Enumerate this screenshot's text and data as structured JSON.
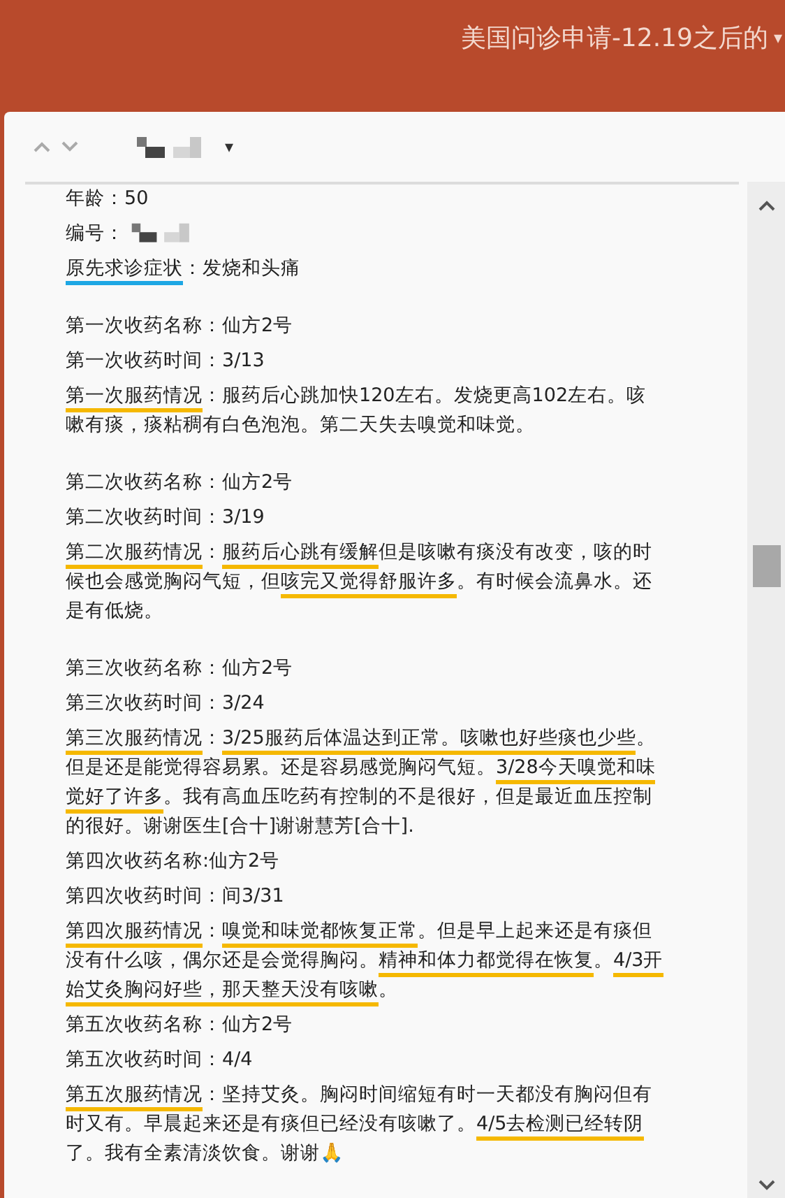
{
  "header": {
    "title": "美国问诊申请-12.19之后的",
    "menu_glyph": "▾"
  },
  "toolbar": {
    "sender_caret": "▾"
  },
  "sections": [
    {
      "lines": [
        {
          "kind": "text",
          "segments": [
            {
              "text": "年龄：50"
            }
          ]
        },
        {
          "kind": "redacted",
          "segments": [
            {
              "text": "编号："
            }
          ]
        },
        {
          "kind": "text",
          "segments": [
            {
              "text": "原先求诊症状",
              "color": "#1ea7e4"
            },
            {
              "text": "：发烧和头痛"
            }
          ]
        }
      ]
    },
    {
      "lines": [
        {
          "kind": "text",
          "segments": [
            {
              "text": "第一次收药名称：仙方2号"
            }
          ]
        },
        {
          "kind": "text",
          "segments": [
            {
              "text": "第一次收药时间：3/13"
            }
          ]
        },
        {
          "kind": "text",
          "segments": [
            {
              "text": "第一次服药情况",
              "color": "#f5b800"
            },
            {
              "text": "：服药后心跳加快120左右。发烧更高102左右。咳嗽有痰，痰粘稠有白色泡泡。第二天失去嗅觉和味觉。"
            }
          ]
        }
      ]
    },
    {
      "lines": [
        {
          "kind": "text",
          "segments": [
            {
              "text": "第二次收药名称：仙方2号"
            }
          ]
        },
        {
          "kind": "text",
          "segments": [
            {
              "text": "第二次收药时间：3/19"
            }
          ]
        },
        {
          "kind": "text",
          "segments": [
            {
              "text": "第二次服药情况",
              "color": "#f5b800"
            },
            {
              "text": "："
            },
            {
              "text": "服药后心跳有缓解",
              "color": "#f5b800"
            },
            {
              "text": "但是咳嗽有痰没有改变，咳的时候也会感觉胸闷气短，但"
            },
            {
              "text": "咳完又觉得舒服许多",
              "color": "#f5b800"
            },
            {
              "text": "。有时候会流鼻水。还是有低烧。"
            }
          ]
        }
      ]
    },
    {
      "lines": [
        {
          "kind": "text",
          "segments": [
            {
              "text": "第三次收药名称：仙方2号"
            }
          ]
        },
        {
          "kind": "text",
          "segments": [
            {
              "text": "第三次收药时间：3/24"
            }
          ]
        },
        {
          "kind": "text",
          "segments": [
            {
              "text": "第三次服药情况",
              "color": "#f5b800"
            },
            {
              "text": "："
            },
            {
              "text": "3/25服药后体温达到正常。咳嗽也好些痰也少些",
              "color": "#f5b800"
            },
            {
              "text": "。但是还是能觉得容易累。还是容易感觉胸闷气短。"
            },
            {
              "text": "3/28今天嗅觉和味觉好了许多",
              "color": "#f5b800"
            },
            {
              "text": "。我有高血压吃药有控制的不是很好，但是最近血压控制的很好。谢谢医生[合十]谢谢慧芳[合十]."
            }
          ]
        },
        {
          "kind": "text",
          "segments": [
            {
              "text": "第四次收药名称:仙方2号"
            }
          ]
        },
        {
          "kind": "text",
          "segments": [
            {
              "text": "第四次收药时间：间3/31"
            }
          ]
        },
        {
          "kind": "text",
          "segments": [
            {
              "text": "第四次服药情况",
              "color": "#f5b800"
            },
            {
              "text": "："
            },
            {
              "text": "嗅觉和味觉都恢复正常",
              "color": "#f5b800"
            },
            {
              "text": "。但是早上起来还是有痰但没有什么咳，偶尔还是会觉得胸闷。"
            },
            {
              "text": "精神和体力都觉得在恢复",
              "color": "#f5b800"
            },
            {
              "text": "。"
            },
            {
              "text": "4/3开始艾灸胸闷好些，那天整天没有咳嗽",
              "color": "#f5b800"
            },
            {
              "text": "。"
            }
          ]
        },
        {
          "kind": "text",
          "segments": [
            {
              "text": "第五次收药名称：仙方2号"
            }
          ]
        },
        {
          "kind": "text",
          "segments": [
            {
              "text": "第五次收药时间：4/4"
            }
          ]
        },
        {
          "kind": "text",
          "segments": [
            {
              "text": "第五次服药情况",
              "color": "#f5b800"
            },
            {
              "text": "：坚持艾灸。胸闷时间缩短有时一天都没有胸闷但有时又有。早晨起来还是有痰但已经没有咳嗽了。"
            },
            {
              "text": "4/5去检测已经转阴",
              "color": "#f5b800"
            },
            {
              "text": "了。我有全素清淡饮食。谢谢🙏"
            }
          ]
        }
      ]
    }
  ]
}
